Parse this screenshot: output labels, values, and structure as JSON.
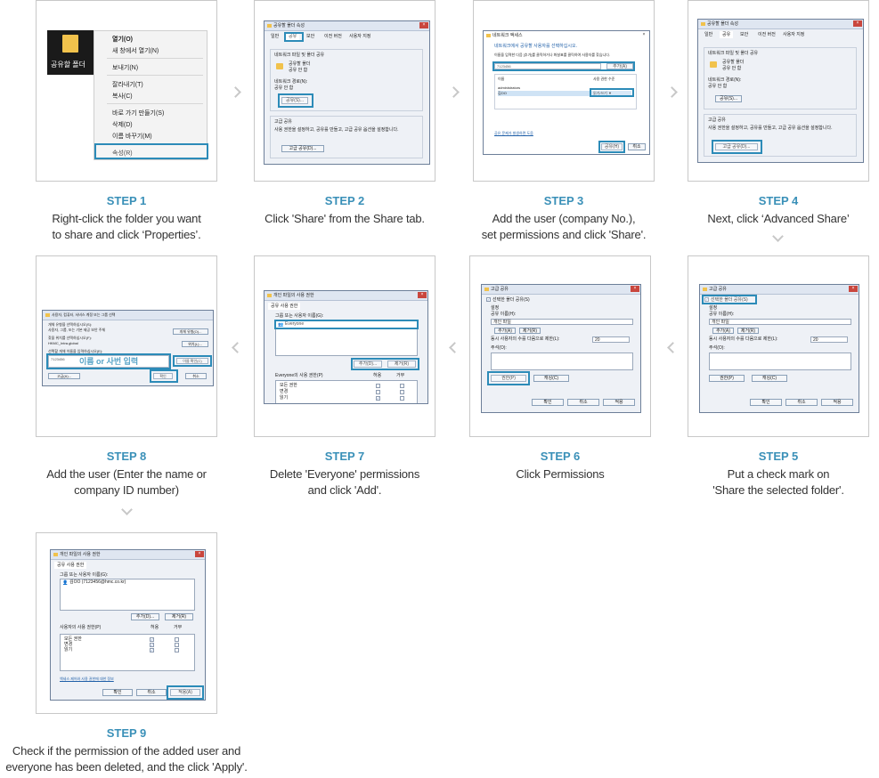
{
  "accent_color": "#2c8bb8",
  "step_color": "#3a90b8",
  "steps": [
    {
      "label": "STEP 1",
      "desc": [
        "Right-click the folder you want",
        "to share and click ‘Properties’."
      ]
    },
    {
      "label": "STEP 2",
      "desc": [
        "Click 'Share' from the Share tab."
      ]
    },
    {
      "label": "STEP 3",
      "desc": [
        "Add the user (company No.),",
        "set permissions and click 'Share'."
      ]
    },
    {
      "label": "STEP 4",
      "desc": [
        "Next, click ‘Advanced Share’"
      ]
    },
    {
      "label": "STEP 5",
      "desc": [
        "Put a check mark on",
        "'Share the selected folder'."
      ]
    },
    {
      "label": "STEP 6",
      "desc": [
        "Click Permissions"
      ]
    },
    {
      "label": "STEP 7",
      "desc": [
        "Delete 'Everyone' permissions",
        "and click 'Add'."
      ]
    },
    {
      "label": "STEP 8",
      "desc": [
        "Add the user (Enter the name or",
        "company ID number)"
      ]
    },
    {
      "label": "STEP 9",
      "desc": [
        "Check if the permission of the added user and",
        "everyone has been deleted, and the click 'Apply'."
      ]
    }
  ],
  "s1": {
    "folder_label": "공유할 폴더",
    "menu": [
      "열기(O)",
      "새 창에서 열기(N)",
      "보내기(N)",
      "잘라내기(T)",
      "복사(C)",
      "바로 가기 만들기(S)",
      "삭제(D)",
      "이름 바꾸기(M)",
      "속성(R)"
    ]
  },
  "props": {
    "title": "공유할 폴더 속성",
    "tabs": [
      "일반",
      "공유",
      "보안",
      "이전 버전",
      "사용자 지정"
    ],
    "net_group": "네트워크 파일 및 폴더 공유",
    "folder_name": "공유할 폴더",
    "not_shared": "공유 안 함",
    "net_path": "네트워크 경로(N):",
    "share_btn": "공유(S)...",
    "adv_group": "고급 공유",
    "adv_text": "사용 권한을 설정하고, 공유를 만들고, 고급 공유 옵션을 설정합니다.",
    "adv_btn": "고급 공유(D)..."
  },
  "s3": {
    "title": "네트워크 액세스",
    "heading": "네트워크에서 공유할 사용자를 선택하십시오.",
    "sub": "이름을 입력한 다음 [추가]를 클릭하거나 화살표를 클릭하여 사용자를 찾습니다.",
    "input_val": "7123456",
    "add_btn": "추가(A)",
    "col_name": "이름",
    "col_perm": "사용 권한 수준",
    "rows": [
      "administrators",
      "김OO"
    ],
    "perm_val": "읽기/쓰기 ▼",
    "link": "공유 문제가 발생하면 도움",
    "share_btn": "공유(H)",
    "cancel_btn": "취소"
  },
  "adv": {
    "title": "고급 공유",
    "check_label": "선택한 폴더 공유(S)",
    "settings": "설정",
    "share_name": "공유 이름(H):",
    "share_val": "개인 파일",
    "add": "추가(A)",
    "remove": "제거(R)",
    "limit": "동시 사용자의 수를 다음으로 제한(L):",
    "limit_val": "20",
    "comment": "주석(O):",
    "perm_btn": "권한(P)",
    "cache_btn": "캐싱(C)",
    "ok": "확인",
    "cancel": "취소",
    "apply": "적용"
  },
  "perm": {
    "title": "개인 파일의 사용 권한",
    "tab": "공유 사용 권한",
    "group_label": "그룹 또는 사용자 이름(G):",
    "everyone": "Everyone",
    "add": "추가(D)...",
    "remove": "제거(R)",
    "perm_label": "Everyone의 사용 권한(P)",
    "allow": "허용",
    "deny": "거부",
    "rows": [
      "모든 권한",
      "변경",
      "읽기"
    ],
    "user_entry": "김OO (7123456@hmc.co.kr)",
    "perm_label9": "사용자의 사용 권한(P)",
    "link": "액세스 제어와 사용 권한에 대한 정보",
    "ok": "확인",
    "cancel": "취소",
    "apply": "적용(A)"
  },
  "s8": {
    "title": "사용자, 컴퓨터, 서비스 계정 또는 그룹 선택",
    "lines": [
      "개체 유형을 선택하십시오(S):",
      "사용자, 그룹, 또는 기본 제공 보안 주체",
      "찾을 위치를 선택하십시오(F):",
      "HKMC_Intra.global"
    ],
    "obj_btn": "개체 유형(O)...",
    "loc_btn": "위치(L)...",
    "enter_label": "선택할 개체 이름을 입력하십시오(E):",
    "input_val": "7123456",
    "hint": "이름 or 사번 입력",
    "check_btn": "이름 확인(C)",
    "adv_btn": "고급(A)...",
    "ok": "확인",
    "cancel": "취소"
  }
}
